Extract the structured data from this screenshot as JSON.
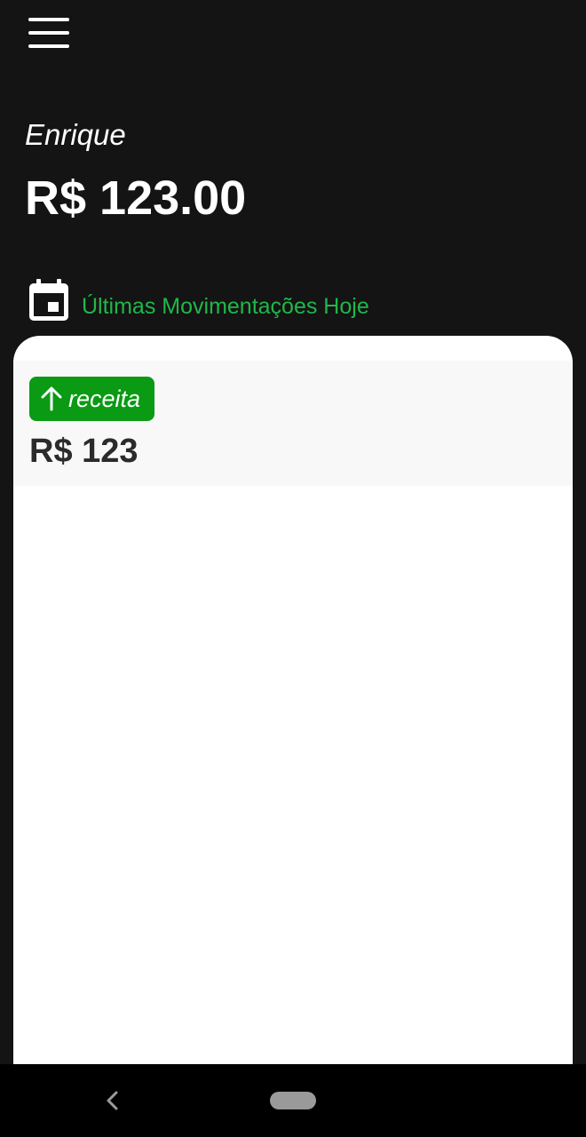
{
  "header": {
    "menu_icon": "hamburger-menu-icon"
  },
  "account": {
    "user_name": "Enrique",
    "balance": "R$ 123.00"
  },
  "movements": {
    "icon": "calendar-icon",
    "title": "Últimas Movimentações Hoje",
    "title_color": "#1fb84a",
    "items": [
      {
        "type_icon": "arrow-up-icon",
        "type_label": "receita",
        "type_color": "#0a9a14",
        "amount": "R$ 123"
      }
    ]
  },
  "navigation": {
    "back_icon": "back-chevron-icon",
    "home_icon": "home-pill-icon"
  }
}
